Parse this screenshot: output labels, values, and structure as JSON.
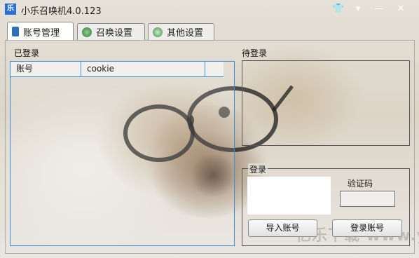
{
  "window": {
    "title": "小乐召唤机4.0.123",
    "logo_text": "乐"
  },
  "titlebar_buttons": [
    {
      "name": "skin-icon",
      "glyph": "👕"
    },
    {
      "name": "menu-icon",
      "glyph": "▾"
    },
    {
      "name": "minimize-icon",
      "glyph": "—"
    },
    {
      "name": "close-icon",
      "glyph": "✕"
    }
  ],
  "tabs": [
    {
      "label": "账号管理",
      "active": true
    },
    {
      "label": "召唤设置",
      "active": false
    },
    {
      "label": "其他设置",
      "active": false
    }
  ],
  "logged_in": {
    "label": "已登录",
    "columns": [
      "账号",
      "cookie"
    ]
  },
  "pending": {
    "label": "待登录"
  },
  "login": {
    "legend": "登录",
    "captcha_label": "验证码",
    "captcha_value": "",
    "import_button": "导入账号",
    "login_button": "登录账号"
  },
  "watermark": "亿乐下载 www.yj.com"
}
